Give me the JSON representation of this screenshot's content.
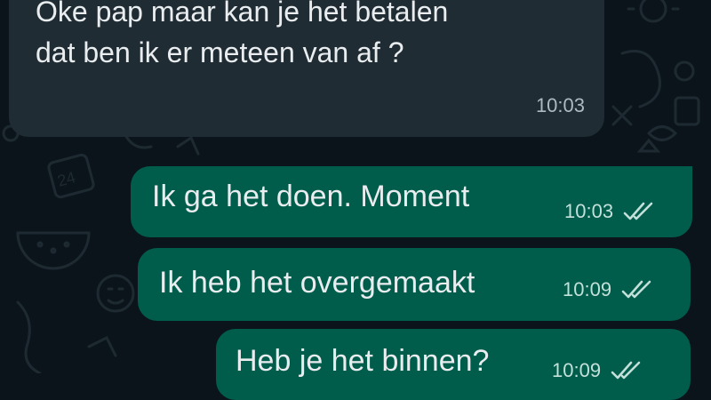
{
  "messages": [
    {
      "direction": "incoming",
      "lines": [
        "Oke pap maar kan je het betalen",
        "dat ben ik er meteen van af ?"
      ],
      "time": "10:03"
    },
    {
      "direction": "outgoing",
      "text": "Ik ga het doen. Moment",
      "time": "10:03",
      "status": "read"
    },
    {
      "direction": "outgoing",
      "text": "Ik heb het overgemaakt",
      "time": "10:09",
      "status": "read"
    },
    {
      "direction": "outgoing",
      "text": "Heb je het binnen?",
      "time": "10:09",
      "status": "read"
    }
  ],
  "colors": {
    "background": "#0b141a",
    "incoming_bubble": "#1f2c33",
    "outgoing_bubble": "#005c4b",
    "text": "#e9edef",
    "read_ticks": "#c3e0d9"
  },
  "icons": [
    "double-check-icon"
  ]
}
